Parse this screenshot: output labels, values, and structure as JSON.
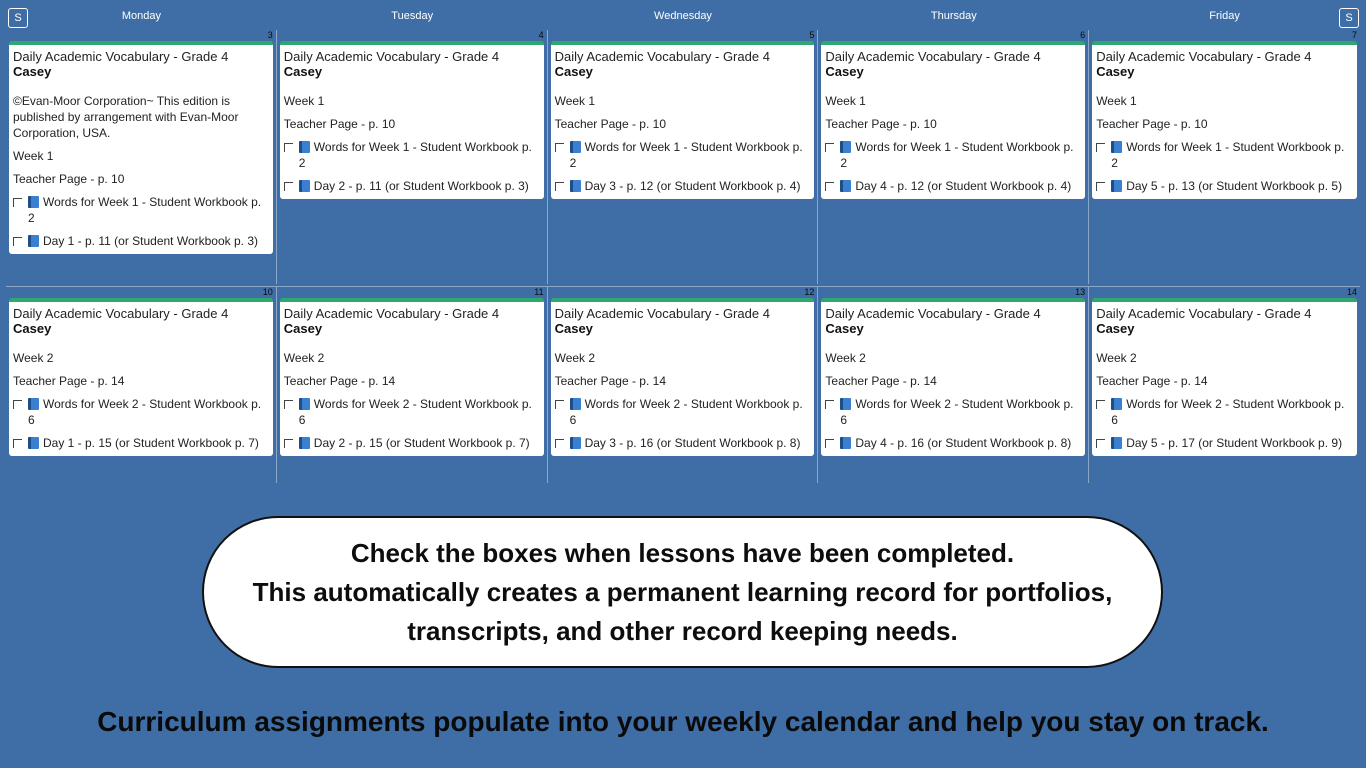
{
  "nav": {
    "prev_label": "S",
    "next_label": "S"
  },
  "days": [
    "Monday",
    "Tuesday",
    "Wednesday",
    "Thursday",
    "Friday"
  ],
  "weeks": [
    {
      "cells": [
        {
          "date": "3",
          "title": "Daily Academic Vocabulary - Grade 4",
          "student": "Casey",
          "notes": [
            "©Evan-Moor Corporation~ This edition is published by arrangement with Evan-Moor Corporation, USA.",
            "Week 1",
            "Teacher Page - p. 10"
          ],
          "tasks": [
            "Words for Week 1 - Student Workbook p. 2",
            "Day 1 - p. 11 (or Student Workbook p. 3)"
          ]
        },
        {
          "date": "4",
          "title": "Daily Academic Vocabulary - Grade 4",
          "student": "Casey",
          "notes": [
            "Week 1",
            "Teacher Page - p. 10"
          ],
          "tasks": [
            "Words for Week 1 - Student Workbook p. 2",
            "Day 2 - p. 11 (or Student Workbook p. 3)"
          ]
        },
        {
          "date": "5",
          "title": "Daily Academic Vocabulary - Grade 4",
          "student": "Casey",
          "notes": [
            "Week 1",
            "Teacher Page - p. 10"
          ],
          "tasks": [
            "Words for Week 1 - Student Workbook p. 2",
            "Day 3 - p. 12 (or Student Workbook p. 4)"
          ]
        },
        {
          "date": "6",
          "title": "Daily Academic Vocabulary - Grade 4",
          "student": "Casey",
          "notes": [
            "Week 1",
            "Teacher Page - p. 10"
          ],
          "tasks": [
            "Words for Week 1 - Student Workbook p. 2",
            "Day 4 - p. 12 (or Student Workbook p. 4)"
          ]
        },
        {
          "date": "7",
          "title": "Daily Academic Vocabulary - Grade 4",
          "student": "Casey",
          "notes": [
            "Week 1",
            "Teacher Page - p. 10"
          ],
          "tasks": [
            "Words for Week 1 - Student Workbook p. 2",
            "Day 5 - p. 13 (or Student Workbook p. 5)"
          ]
        }
      ]
    },
    {
      "cells": [
        {
          "date": "10",
          "title": "Daily Academic Vocabulary - Grade 4",
          "student": "Casey",
          "notes": [
            "Week 2",
            "Teacher Page - p. 14"
          ],
          "tasks": [
            "Words for Week 2 - Student Workbook p. 6",
            "Day 1 - p. 15 (or Student Workbook p. 7)"
          ]
        },
        {
          "date": "11",
          "title": "Daily Academic Vocabulary - Grade 4",
          "student": "Casey",
          "notes": [
            "Week 2",
            "Teacher Page - p. 14"
          ],
          "tasks": [
            "Words for Week 2 - Student Workbook p. 6",
            "Day 2 - p. 15 (or Student Workbook p. 7)"
          ]
        },
        {
          "date": "12",
          "title": "Daily Academic Vocabulary - Grade 4",
          "student": "Casey",
          "notes": [
            "Week 2",
            "Teacher Page - p. 14"
          ],
          "tasks": [
            "Words for Week 2 - Student Workbook p. 6",
            "Day 3 - p. 16 (or Student Workbook p. 8)"
          ]
        },
        {
          "date": "13",
          "title": "Daily Academic Vocabulary - Grade 4",
          "student": "Casey",
          "notes": [
            "Week 2",
            "Teacher Page - p. 14"
          ],
          "tasks": [
            "Words for Week 2 - Student Workbook p. 6",
            "Day 4 - p. 16 (or Student Workbook p. 8)"
          ]
        },
        {
          "date": "14",
          "title": "Daily Academic Vocabulary - Grade 4",
          "student": "Casey",
          "notes": [
            "Week 2",
            "Teacher Page - p. 14"
          ],
          "tasks": [
            "Words for Week 2 - Student Workbook p. 6",
            "Day 5 - p. 17 (or Student Workbook p. 9)"
          ]
        }
      ]
    }
  ],
  "callout": {
    "lines": [
      "Check the boxes when lessons have been completed.",
      "This automatically creates a permanent learning record for portfolios,",
      "transcripts, and other record keeping needs."
    ]
  },
  "footer": {
    "text": "Curriculum assignments populate into your weekly calendar and help you stay on track."
  },
  "colors": {
    "background": "#3f6ea6",
    "card_accent": "#2ea86e",
    "card": "#ffffff"
  },
  "icons": {
    "task_icon": "book-icon"
  }
}
